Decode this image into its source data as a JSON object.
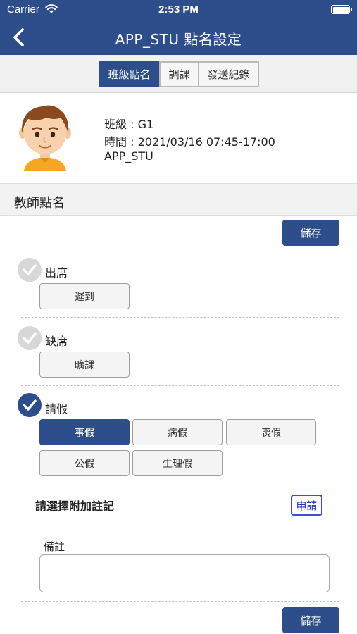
{
  "status_bar": {
    "carrier": "Carrier",
    "time": "2:53 PM"
  },
  "nav": {
    "title": "APP_STU 點名設定",
    "icon": "back-chevron-icon"
  },
  "tabs": [
    {
      "label": "班級點名",
      "active": true
    },
    {
      "label": "調課",
      "active": false
    },
    {
      "label": "發送紀錄",
      "active": false
    }
  ],
  "student": {
    "class_line": "班級 : G1",
    "time_line": "時間 : 2021/03/16 07:45-17:00",
    "name": "APP_STU",
    "avatar_icon": "student-avatar-icon"
  },
  "section": {
    "title": "教師點名"
  },
  "save_label": "儲存",
  "attendance": {
    "present": {
      "label": "出席",
      "checked": false,
      "options": [
        "遲到"
      ]
    },
    "absent": {
      "label": "缺席",
      "checked": false,
      "options": [
        "曠課"
      ]
    },
    "leave": {
      "label": "請假",
      "checked": true,
      "options": [
        "事假",
        "病假",
        "喪假",
        "公假",
        "生理假"
      ],
      "selected": "事假"
    }
  },
  "note": {
    "label": "請選擇附加註記",
    "apply_label": "申請"
  },
  "remark": {
    "label": "備註",
    "value": ""
  },
  "colors": {
    "primary": "#2d4e8a",
    "apply_border": "#3a4fd4",
    "unchecked": "#d7d7d7"
  }
}
